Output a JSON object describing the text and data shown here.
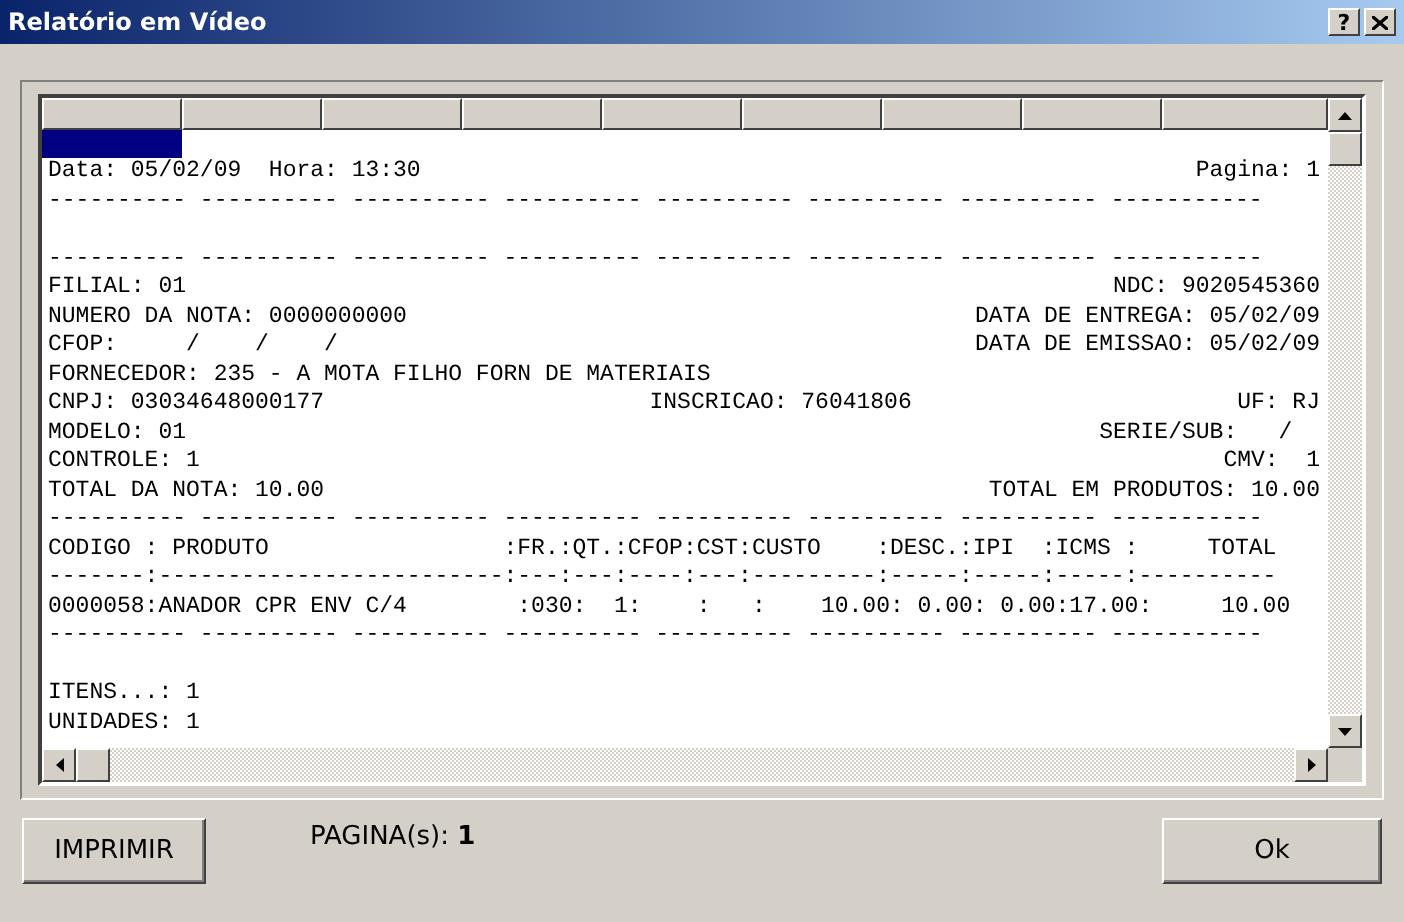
{
  "window": {
    "title": "Relatório em Vídeo",
    "help_button": "?"
  },
  "report": {
    "lines": [
      {
        "kind": "split",
        "parts": [
          "Data: 05/02/09  Hora: 13:30",
          "Pagina: 1"
        ]
      },
      {
        "kind": "rule",
        "text": "---------- ---------- ---------- ---------- ---------- ---------- ---------- -----------"
      },
      {
        "kind": "blank"
      },
      {
        "kind": "rule",
        "text": "---------- ---------- ---------- ---------- ---------- ---------- ---------- -----------"
      },
      {
        "kind": "split",
        "parts": [
          "FILIAL: 01",
          "NDC: 9020545360"
        ]
      },
      {
        "kind": "split",
        "parts": [
          "NUMERO DA NOTA: 0000000000",
          "DATA DE ENTREGA: 05/02/09"
        ]
      },
      {
        "kind": "split",
        "parts": [
          "CFOP:     /    /    /",
          "DATA DE EMISSAO: 05/02/09"
        ]
      },
      {
        "kind": "split",
        "parts": [
          "FORNECEDOR: 235 - A MOTA FILHO FORN DE MATERIAIS"
        ]
      },
      {
        "kind": "split",
        "parts": [
          "CNPJ: 03034648000177",
          "INSCRICAO: 76041806",
          "UF: RJ"
        ]
      },
      {
        "kind": "split",
        "parts": [
          "MODELO: 01",
          "SERIE/SUB:   /  "
        ]
      },
      {
        "kind": "split",
        "parts": [
          "CONTROLE: 1",
          "CMV:  1"
        ]
      },
      {
        "kind": "split",
        "parts": [
          "TOTAL DA NOTA: 10.00",
          "TOTAL EM PRODUTOS: 10.00"
        ]
      },
      {
        "kind": "rule",
        "text": "---------- ---------- ---------- ---------- ---------- ---------- ---------- -----------"
      },
      {
        "kind": "table",
        "text": "CODIGO : PRODUTO                 :FR.:QT.:CFOP:CST:CUSTO    :DESC.:IPI  :ICMS :     TOTAL"
      },
      {
        "kind": "table",
        "text": "-------:-------------------------:---:---:----:---:---------:-----:-----:-----:----------"
      },
      {
        "kind": "table",
        "text": "0000058:ANADOR CPR ENV C/4        :030:  1:    :   :    10.00: 0.00: 0.00:17.00:     10.00"
      },
      {
        "kind": "rule",
        "text": "---------- ---------- ---------- ---------- ---------- ---------- ---------- -----------"
      },
      {
        "kind": "blank"
      },
      {
        "kind": "split",
        "parts": [
          "ITENS...: 1"
        ]
      },
      {
        "kind": "split",
        "parts": [
          "UNIDADES: 1"
        ]
      }
    ]
  },
  "footer": {
    "print_button": "IMPRIMIR",
    "pages_label": "PAGINA(s): **1**",
    "ok_button": "Ok"
  }
}
